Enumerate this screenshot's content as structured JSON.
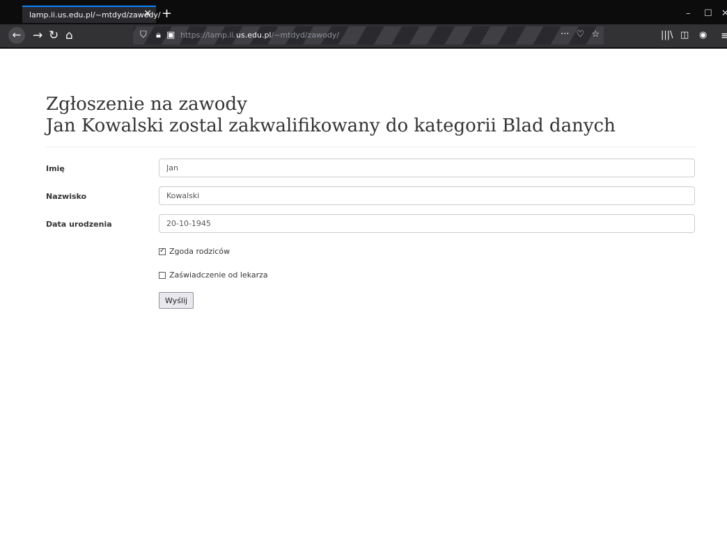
{
  "browser": {
    "tab_title": "lamp.ii.us.edu.pl/~mtdyd/zawody/",
    "url_scheme": "https://lamp.ii.",
    "url_domain": "us.edu.pl",
    "url_path": "/~mtdyd/zawody/"
  },
  "page": {
    "heading_line1": "Zgłoszenie na zawody",
    "heading_line2": "Jan Kowalski zostal zakwalifikowany do kategorii Blad danych"
  },
  "form": {
    "first_name_label": "Imię",
    "first_name_value": "Jan",
    "last_name_label": "Nazwisko",
    "last_name_value": "Kowalski",
    "birthdate_label": "Data urodzenia",
    "birthdate_value": "20-10-1945",
    "parents_consent_label": "Zgoda rodziców",
    "parents_consent_checked": true,
    "doctor_cert_label": "Zaświadczenie od lekarza",
    "doctor_cert_checked": false,
    "submit_label": "Wyślij"
  }
}
